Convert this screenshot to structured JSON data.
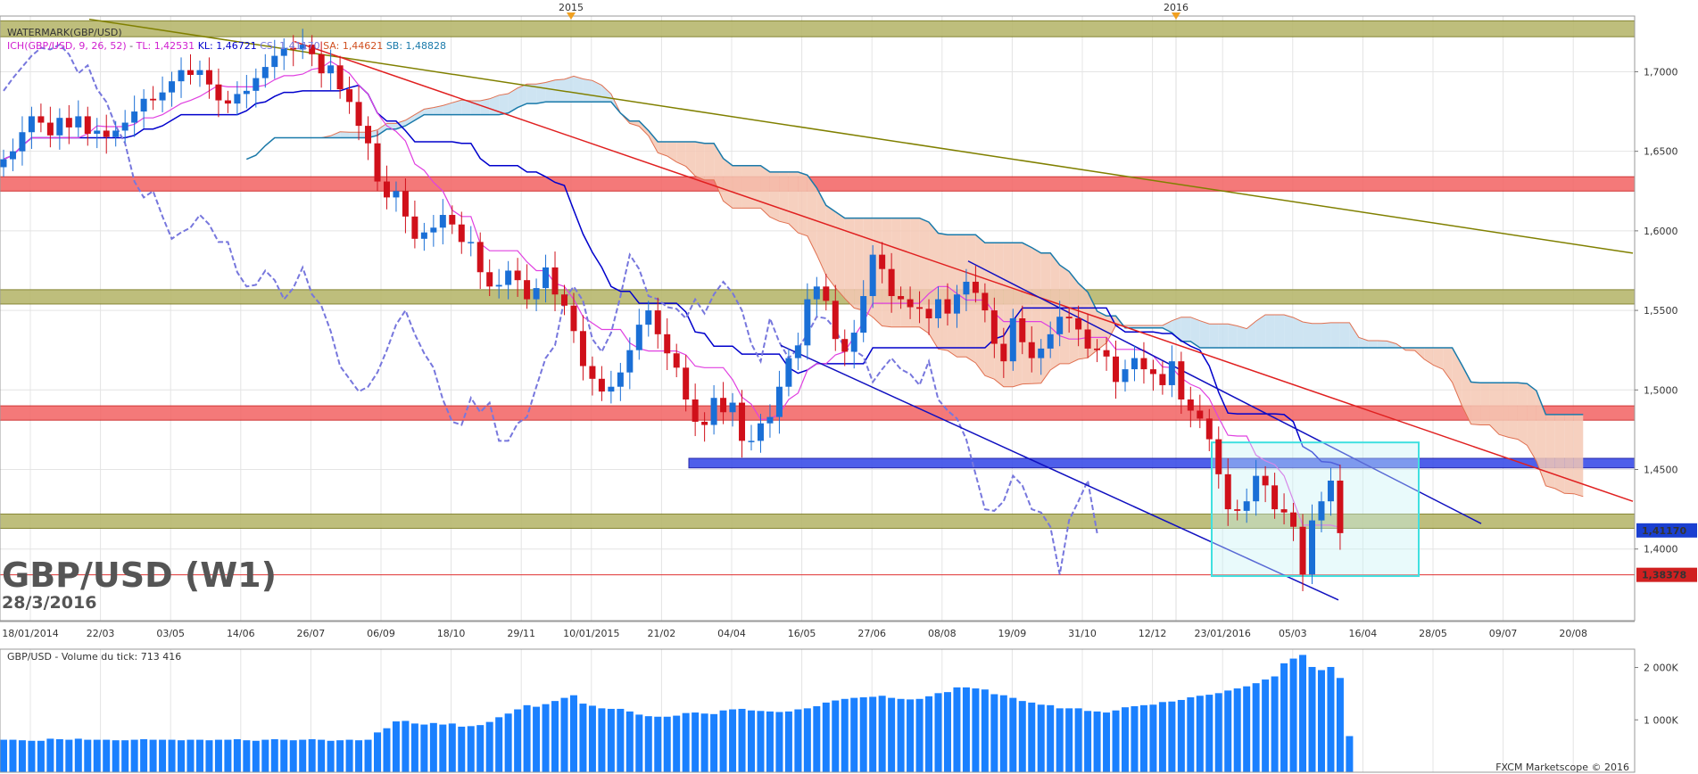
{
  "chart_data": {
    "type": "candlestick",
    "symbol_label": "GBP/USD (W1)",
    "date_label": "28/3/2016",
    "indicator_labels": {
      "watermark": "WATERMARK(GBP/USD)",
      "ichimoku_name": "ICH(GBP/USD, 9, 26, 52)",
      "tl": "TL: 1,42531",
      "kl": "KL: 1,46721",
      "cs": "CS: 1,41170",
      "sa": "SA: 1,44621",
      "sb": "SB: 1,48828"
    },
    "volume_label": "GBP/USD - Volume du tick: 713 416",
    "copyright": "FXCM Marketscope © 2016",
    "year_markers": [
      "2015",
      "2016"
    ],
    "price_ticks": [
      "1,7000",
      "1,6500",
      "1,6000",
      "1,5500",
      "1,5000",
      "1,4500",
      "1,4000"
    ],
    "price_tick_values": [
      1.7,
      1.65,
      1.6,
      1.55,
      1.5,
      1.45,
      1.4
    ],
    "ylim": [
      1.355,
      1.735
    ],
    "current_price_tag": "1,41170",
    "current_price": 1.4117,
    "support_price_tag": "1,38378",
    "support_price": 1.38378,
    "volume_ticks": [
      "2 000K",
      "1 000K"
    ],
    "volume_tick_values": [
      2000,
      1000
    ],
    "volume_ylim": [
      0,
      2350
    ],
    "date_ticks": [
      "18/01/2014",
      "22/03",
      "03/05",
      "14/06",
      "26/07",
      "06/09",
      "18/10",
      "29/11",
      "10/01/2015",
      "21/02",
      "04/04",
      "16/05",
      "27/06",
      "08/08",
      "19/09",
      "31/10",
      "12/12",
      "23/01/2016",
      "05/03",
      "16/04",
      "28/05",
      "09/07",
      "20/08"
    ],
    "horizontal_zones": [
      {
        "type": "olive",
        "from": 1.722,
        "to": 1.732
      },
      {
        "type": "red",
        "from": 1.625,
        "to": 1.634
      },
      {
        "type": "olive",
        "from": 1.554,
        "to": 1.563
      },
      {
        "type": "red",
        "from": 1.481,
        "to": 1.49
      },
      {
        "type": "blue",
        "from": 1.451,
        "to": 1.457
      },
      {
        "type": "olive",
        "from": 1.413,
        "to": 1.422
      }
    ],
    "colors": {
      "bull": "#1a6fd6",
      "bear": "#d0101a",
      "kijun": "#0000cc",
      "tenkan": "#e040e0",
      "chikou": "#7777dd",
      "senkou_b": "#1a7aaa",
      "cloud_bull": "#c6dff0",
      "cloud_bear": "#f4c8b4",
      "trend_red": "#e02020",
      "trend_olive": "#808000",
      "channel": "#1010c0",
      "volume": "#1a80ff",
      "highlight": "#40e0e0"
    },
    "weekly_closes": [
      1.645,
      1.65,
      1.662,
      1.672,
      1.668,
      1.66,
      1.671,
      1.665,
      1.672,
      1.661,
      1.663,
      1.659,
      1.663,
      1.668,
      1.675,
      1.683,
      1.682,
      1.687,
      1.694,
      1.701,
      1.698,
      1.701,
      1.692,
      1.682,
      1.68,
      1.686,
      1.688,
      1.696,
      1.703,
      1.71,
      1.715,
      1.714,
      1.717,
      1.711,
      1.699,
      1.704,
      1.689,
      1.681,
      1.666,
      1.655,
      1.631,
      1.621,
      1.625,
      1.609,
      1.595,
      1.599,
      1.602,
      1.61,
      1.604,
      1.593,
      1.593,
      1.574,
      1.565,
      1.566,
      1.575,
      1.569,
      1.557,
      1.564,
      1.577,
      1.56,
      1.553,
      1.537,
      1.515,
      1.507,
      1.499,
      1.502,
      1.511,
      1.525,
      1.541,
      1.55,
      1.535,
      1.523,
      1.514,
      1.494,
      1.48,
      1.478,
      1.495,
      1.486,
      1.492,
      1.468,
      1.468,
      1.479,
      1.483,
      1.502,
      1.52,
      1.528,
      1.557,
      1.565,
      1.556,
      1.532,
      1.524,
      1.536,
      1.559,
      1.585,
      1.576,
      1.559,
      1.557,
      1.552,
      1.551,
      1.545,
      1.557,
      1.548,
      1.56,
      1.568,
      1.561,
      1.55,
      1.529,
      1.518,
      1.545,
      1.53,
      1.52,
      1.526,
      1.535,
      1.546,
      1.545,
      1.538,
      1.526,
      1.525,
      1.521,
      1.505,
      1.513,
      1.52,
      1.513,
      1.51,
      1.503,
      1.518,
      1.494,
      1.487,
      1.482,
      1.469,
      1.447,
      1.425,
      1.424,
      1.43,
      1.446,
      1.44,
      1.425,
      1.423,
      1.414,
      1.384,
      1.418,
      1.43,
      1.443,
      1.41
    ],
    "weekly_volumes": [
      620,
      620,
      610,
      600,
      600,
      640,
      630,
      620,
      640,
      620,
      620,
      620,
      610,
      610,
      620,
      630,
      620,
      620,
      620,
      610,
      620,
      620,
      610,
      620,
      620,
      630,
      610,
      600,
      620,
      630,
      620,
      610,
      620,
      630,
      620,
      600,
      610,
      620,
      610,
      620,
      760,
      840,
      970,
      980,
      930,
      910,
      940,
      910,
      930,
      870,
      880,
      900,
      960,
      1050,
      1120,
      1200,
      1280,
      1250,
      1300,
      1360,
      1420,
      1470,
      1310,
      1270,
      1220,
      1210,
      1210,
      1160,
      1100,
      1070,
      1060,
      1060,
      1080,
      1130,
      1140,
      1120,
      1110,
      1180,
      1200,
      1210,
      1180,
      1170,
      1160,
      1150,
      1160,
      1200,
      1220,
      1260,
      1330,
      1370,
      1400,
      1420,
      1430,
      1440,
      1460,
      1420,
      1400,
      1390,
      1400,
      1450,
      1510,
      1530,
      1620,
      1620,
      1600,
      1580,
      1490,
      1470,
      1420,
      1360,
      1330,
      1290,
      1280,
      1220,
      1220,
      1220,
      1170,
      1160,
      1140,
      1180,
      1240,
      1260,
      1280,
      1290,
      1340,
      1350,
      1380,
      1430,
      1460,
      1480,
      1510,
      1560,
      1600,
      1640,
      1700,
      1770,
      1830,
      2080,
      2170,
      2240,
      2010,
      1950,
      2010,
      1800,
      690
    ]
  }
}
